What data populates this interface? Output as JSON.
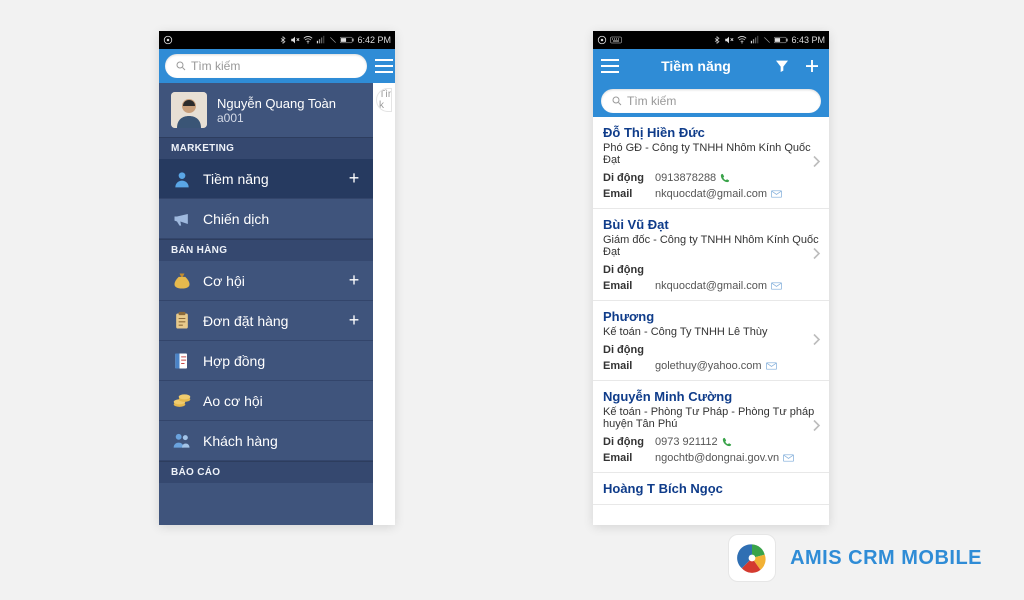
{
  "statusbar_a": {
    "time": "6:42 PM"
  },
  "statusbar_b": {
    "time": "6:43 PM"
  },
  "search": {
    "placeholder": "Tìm kiếm"
  },
  "phone_a": {
    "profile": {
      "name": "Nguyễn Quang Toàn",
      "code": "a001"
    },
    "sections": {
      "marketing": "MARKETING",
      "banhang": "BÁN HÀNG",
      "baocao": "BÁO CÁO"
    },
    "items": {
      "tiemnang": {
        "label": "Tiềm năng",
        "has_plus": true
      },
      "chiendich": {
        "label": "Chiến dịch",
        "has_plus": false
      },
      "cohoi": {
        "label": "Cơ hội",
        "has_plus": true
      },
      "dondat": {
        "label": "Đơn đặt hàng",
        "has_plus": true
      },
      "hopdong": {
        "label": "Hợp đồng",
        "has_plus": false
      },
      "aocohoi": {
        "label": "Ao cơ hội",
        "has_plus": false
      },
      "khachhang": {
        "label": "Khách hàng",
        "has_plus": false
      }
    },
    "strip_search_stub": "Tìm k"
  },
  "phone_b": {
    "title": "Tiềm năng",
    "labels": {
      "mobile": "Di động",
      "email": "Email"
    },
    "contacts": [
      {
        "name": "Đỗ Thị Hiền Đức",
        "sub": "Phó GĐ - Công ty TNHH Nhôm Kính Quốc Đạt",
        "mobile": "0913878288",
        "email": "nkquocdat@gmail.com",
        "has_phone_icon": true
      },
      {
        "name": "Bùi Vũ Đạt",
        "sub": "Giám đốc - Công ty TNHH Nhôm Kính Quốc Đạt",
        "mobile": "",
        "email": "nkquocdat@gmail.com",
        "has_phone_icon": false
      },
      {
        "name": "Phương",
        "sub": "Kế toán - Công Ty TNHH Lê Thùy",
        "mobile": "",
        "email": "golethuy@yahoo.com",
        "has_phone_icon": false
      },
      {
        "name": "Nguyễn Minh Cường",
        "sub": "Kế toán - Phòng Tư Pháp - Phòng Tư pháp huyện Tân Phú",
        "mobile": "0973 921112",
        "email": "ngochtb@dongnai.gov.vn",
        "has_phone_icon": true
      },
      {
        "name": "Hoàng T Bích Ngọc",
        "sub": "",
        "mobile": "",
        "email": "",
        "partial": true
      }
    ]
  },
  "footer": {
    "text": "AMIS CRM MOBILE"
  }
}
